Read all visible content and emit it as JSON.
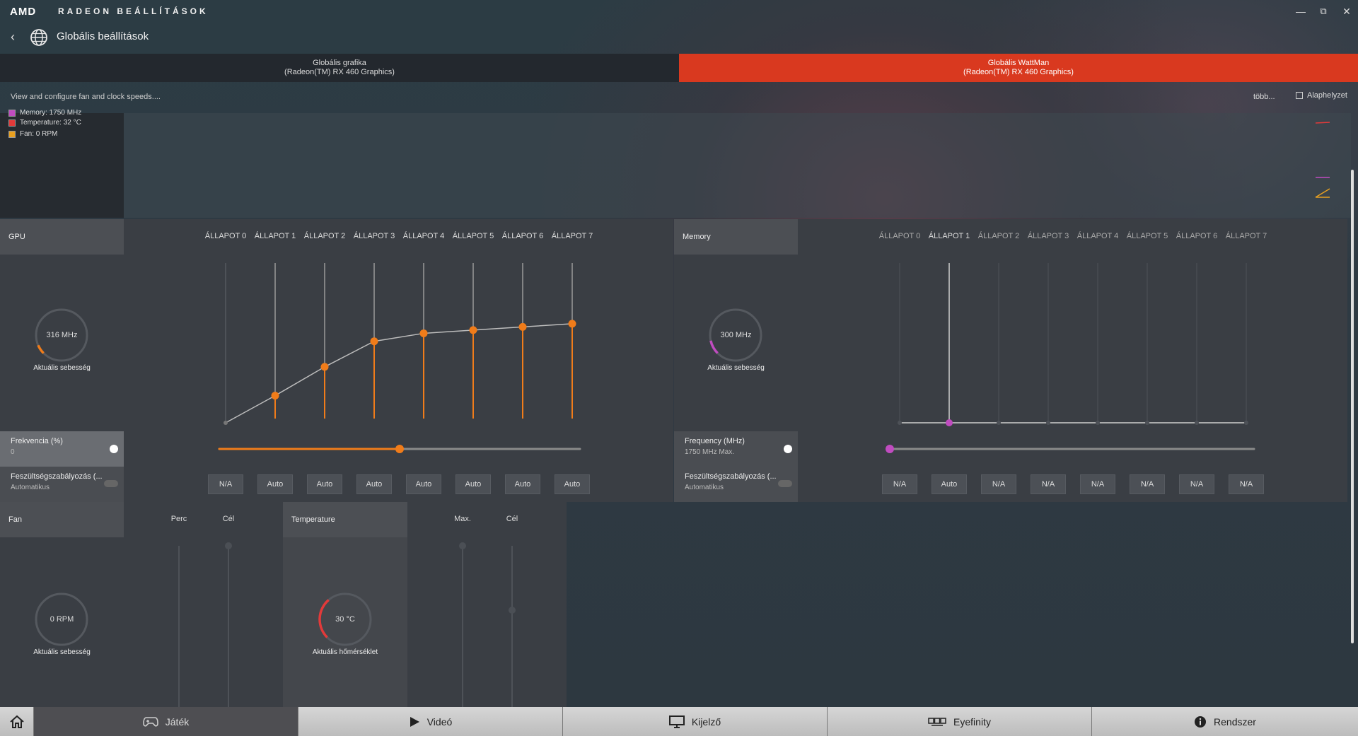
{
  "app": {
    "logo": "AMD",
    "title": "RADEON BEÁLLÍTÁSOK"
  },
  "nav": {
    "title": "Globális beállítások"
  },
  "tabs": [
    {
      "line1": "Globális grafika",
      "line2": "(Radeon(TM) RX 460 Graphics)"
    },
    {
      "line1": "Globális WattMan",
      "line2": "(Radeon(TM) RX 460 Graphics)"
    }
  ],
  "toolbar": {
    "description": "View and configure fan and clock speeds....",
    "more": "több...",
    "reset": "Alaphelyzet"
  },
  "legend": [
    {
      "label": "Memory: 1750 MHz",
      "color": "#c04cc0"
    },
    {
      "label": "Temperature: 32 °C",
      "color": "#e23a3a"
    },
    {
      "label": "Fan: 0 RPM",
      "color": "#e8a020"
    }
  ],
  "gpu": {
    "title": "GPU",
    "gauge_value": "316 MHz",
    "gauge_label": "Aktuális sebesség",
    "gauge_level": 0.08,
    "states": [
      "ÁLLAPOT 0",
      "ÁLLAPOT 1",
      "ÁLLAPOT 2",
      "ÁLLAPOT 3",
      "ÁLLAPOT 4",
      "ÁLLAPOT 5",
      "ÁLLAPOT 6",
      "ÁLLAPOT 7"
    ],
    "state_levels": [
      0.0,
      0.17,
      0.35,
      0.51,
      0.56,
      0.58,
      0.6,
      0.62
    ],
    "freq_label": "Frekvencia (%)",
    "freq_value": "0",
    "freq_slider": 0.5,
    "volt_label": "Feszültségszabályozás (...",
    "volt_value": "Automatikus",
    "volt_buttons": [
      "N/A",
      "Auto",
      "Auto",
      "Auto",
      "Auto",
      "Auto",
      "Auto",
      "Auto"
    ]
  },
  "memory": {
    "title": "Memory",
    "gauge_value": "300 MHz",
    "gauge_label": "Aktuális sebesség",
    "gauge_level": 0.12,
    "states": [
      "ÁLLAPOT 0",
      "ÁLLAPOT 1",
      "ÁLLAPOT 2",
      "ÁLLAPOT 3",
      "ÁLLAPOT 4",
      "ÁLLAPOT 5",
      "ÁLLAPOT 6",
      "ÁLLAPOT 7"
    ],
    "active_state": 1,
    "freq_label": "Frequency (MHz)",
    "freq_value": "1750 MHz Max.",
    "freq_slider": 0.0,
    "volt_label": "Feszültségszabályozás (...",
    "volt_value": "Automatikus",
    "volt_buttons": [
      "N/A",
      "Auto",
      "N/A",
      "N/A",
      "N/A",
      "N/A",
      "N/A",
      "N/A"
    ]
  },
  "fan": {
    "title": "Fan",
    "col1": "Perc",
    "col2": "Cél",
    "gauge_value": "0 RPM",
    "gauge_label": "Aktuális sebesség",
    "gauge_level": 0.0
  },
  "temperature": {
    "title": "Temperature",
    "col1": "Max.",
    "col2": "Cél",
    "gauge_value": "30 °C",
    "gauge_label": "Aktuális hőmérséklet",
    "gauge_level": 0.35
  },
  "bottom_nav": [
    {
      "label": "",
      "icon": "home-icon"
    },
    {
      "label": "Játék",
      "icon": "gamepad-icon"
    },
    {
      "label": "Videó",
      "icon": "play-icon"
    },
    {
      "label": "Kijelző",
      "icon": "display-icon"
    },
    {
      "label": "Eyefinity",
      "icon": "eyefinity-icon"
    },
    {
      "label": "Rendszer",
      "icon": "info-icon"
    }
  ],
  "colors": {
    "accent": "#d9391f",
    "gpu": "#f07c1a",
    "memory": "#c04cc0",
    "temp": "#e23a3a"
  }
}
